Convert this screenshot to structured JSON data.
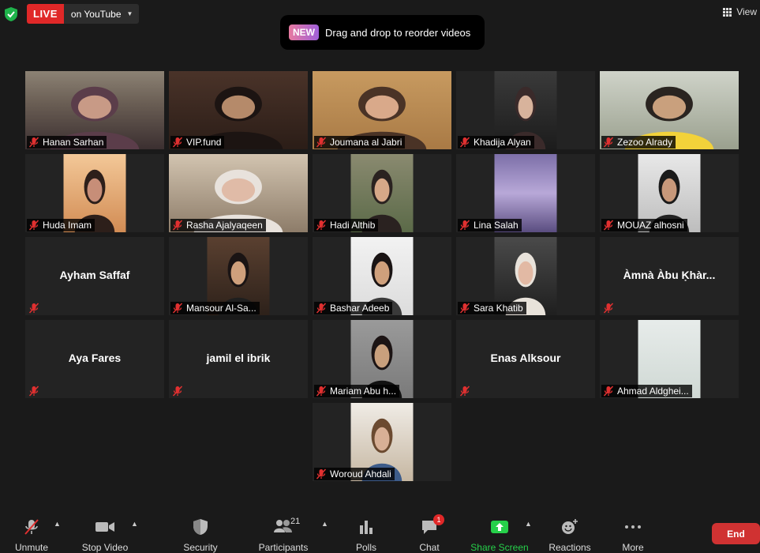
{
  "top": {
    "live_badge": "LIVE",
    "live_target": "on YouTube",
    "view_label": "View",
    "toast_badge": "NEW",
    "toast_text": "Drag and drop to reorder videos"
  },
  "participants": [
    {
      "name": "Hanan Sarhan",
      "video": true
    },
    {
      "name": "VIP.fund",
      "video": true
    },
    {
      "name": "Joumana al Jabri",
      "video": true,
      "active_speaker": true
    },
    {
      "name": "Khadija Alyan",
      "video": true
    },
    {
      "name": "Zezoo Alrady",
      "video": true
    },
    {
      "name": "Huda Imam",
      "video": true
    },
    {
      "name": "Rasha Ajalyaqeen",
      "video": true
    },
    {
      "name": "Hadi Althib",
      "video": true
    },
    {
      "name": "Lina Salah",
      "video": true
    },
    {
      "name": "MOUAZ alhosni",
      "video": true
    },
    {
      "name": "Ayham Saffaf",
      "video": false
    },
    {
      "name": "Mansour Al-Sa...",
      "video": true
    },
    {
      "name": "Bashar Adeeb",
      "video": true
    },
    {
      "name": "Sara Khatib",
      "video": true
    },
    {
      "name": "Àmnà Àbu Ḳhàr...",
      "video": false
    },
    {
      "name": "Aya Fares",
      "video": false
    },
    {
      "name": "jamil el ibrik",
      "video": false
    },
    {
      "name": "Mariam Abu h...",
      "video": true
    },
    {
      "name": "Enas Alksour",
      "video": false
    },
    {
      "name": "Ahmad Aldghei...",
      "video": true
    },
    {
      "name": "Woroud Ahdali",
      "video": true
    }
  ],
  "toolbar": {
    "unmute": "Unmute",
    "stop_video": "Stop Video",
    "security": "Security",
    "participants": "Participants",
    "participants_count": "21",
    "polls": "Polls",
    "chat": "Chat",
    "chat_badge": "1",
    "share_screen": "Share Screen",
    "reactions": "Reactions",
    "more": "More",
    "end": "End"
  },
  "colors": {
    "live_red": "#e02828",
    "active_border": "#c9e27a",
    "share_green": "#26d04a",
    "end_red": "#d03232",
    "muted_mic_red": "#e03030"
  }
}
